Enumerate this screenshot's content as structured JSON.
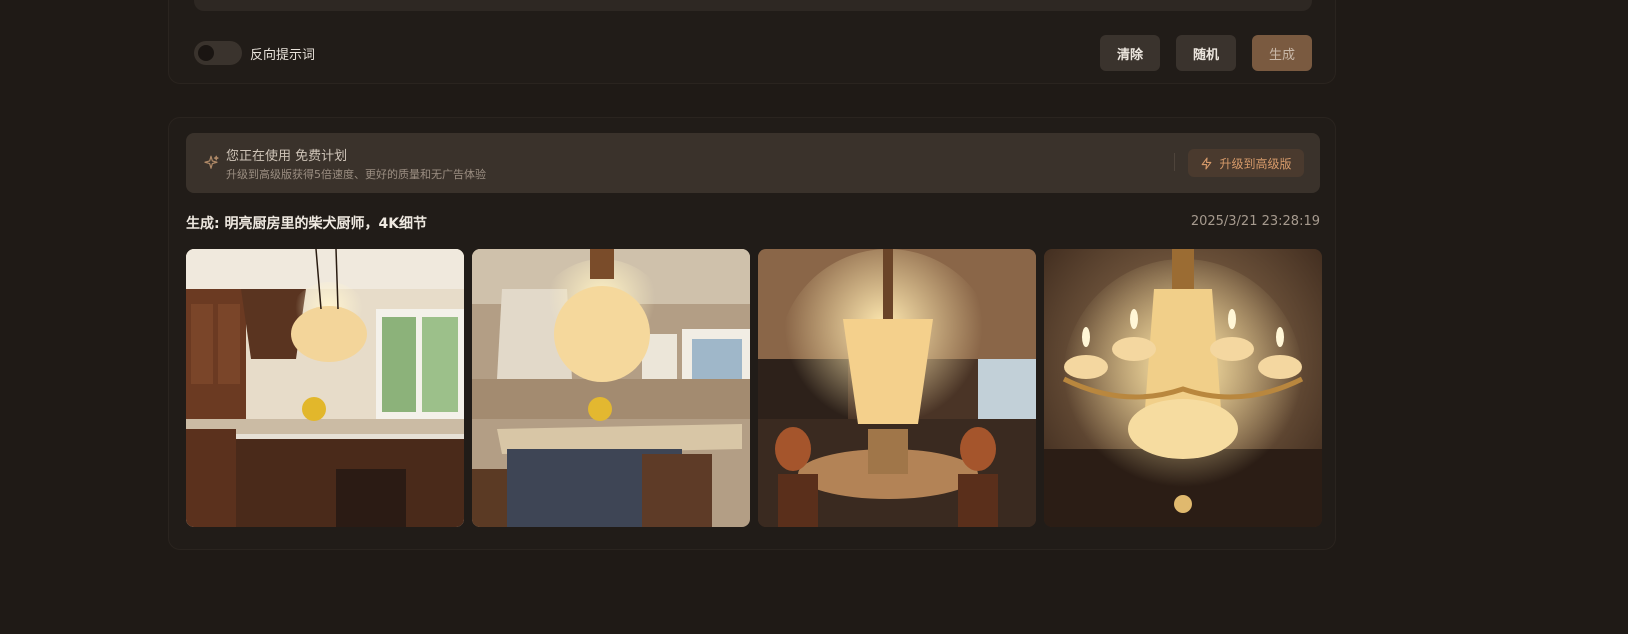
{
  "toolbar": {
    "negative_prompt_label": "反向提示词",
    "clear_label": "清除",
    "random_label": "随机",
    "generate_label": "生成"
  },
  "plan_banner": {
    "title": "您正在使用 免费计划",
    "subtitle": "升级到高级版获得5倍速度、更好的质量和无广告体验",
    "upgrade_label": "升级到高级版",
    "icon": "sparkle-icon",
    "upgrade_icon": "lightning-icon"
  },
  "generation": {
    "title": "生成: 明亮厨房里的柴犬厨师，4K细节",
    "timestamp": "2025/3/21 23:28:19",
    "images": [
      {
        "subject": "kitchen-island-chandelier"
      },
      {
        "subject": "kitchen-crystal-chandelier"
      },
      {
        "subject": "dining-room-chandelier"
      },
      {
        "subject": "candle-crystal-chandelier"
      }
    ]
  },
  "colors": {
    "background": "#1f1a16",
    "panel": "#211c18",
    "button": "#3a332d",
    "generate_button": "#7a5a40",
    "accent": "#d69a6a"
  }
}
